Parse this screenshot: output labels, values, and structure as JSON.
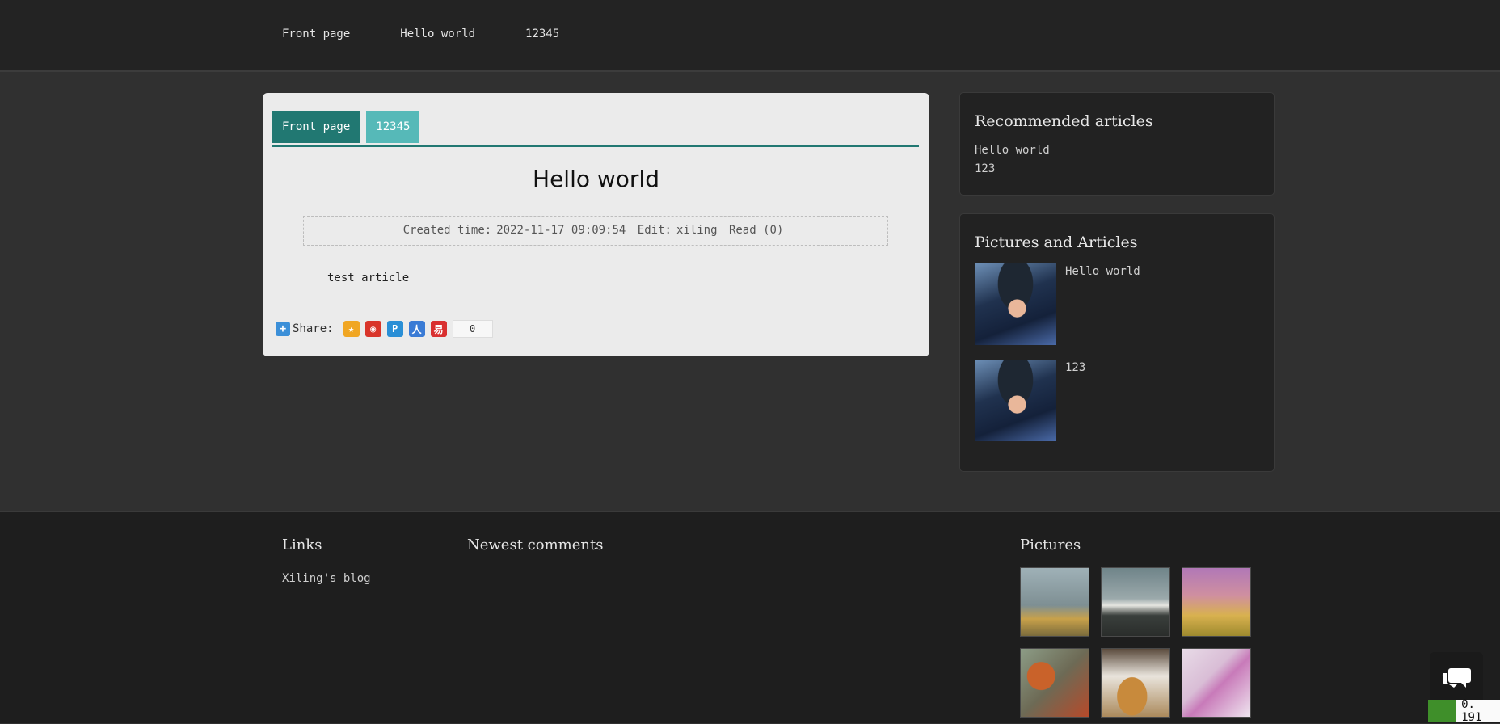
{
  "nav": {
    "items": [
      "Front page",
      "Hello world",
      "12345"
    ]
  },
  "breadcrumb": {
    "home": "Front page",
    "current": "12345"
  },
  "article": {
    "title": "Hello world",
    "created_label": "Created time:",
    "created_value": "2022-11-17 09:09:54",
    "edit_label": "Edit:",
    "edit_value": "xiling",
    "read_label": "Read (0)",
    "body": "test article"
  },
  "share": {
    "label": "Share:",
    "count": "0",
    "icons": [
      "qzone-icon",
      "weibo-icon",
      "tencent-weibo-icon",
      "renren-icon",
      "netease-icon"
    ],
    "colors": [
      "#f0a623",
      "#d9352a",
      "#2a8fd6",
      "#3a7bd5",
      "#d93030"
    ]
  },
  "sidebar": {
    "recommended": {
      "title": "Recommended articles",
      "items": [
        "Hello world",
        "123"
      ]
    },
    "pictures": {
      "title": "Pictures and Articles",
      "items": [
        "Hello world",
        "123"
      ]
    }
  },
  "footer": {
    "links": {
      "title": "Links",
      "items": [
        "Xiling's blog"
      ]
    },
    "comments": {
      "title": "Newest comments"
    },
    "pictures": {
      "title": "Pictures"
    }
  },
  "perf": {
    "value": "0. 191"
  },
  "colors": {
    "accent": "#217872",
    "accent_light": "#56b9b8",
    "page_bg": "#303030",
    "header_bg": "#232323"
  }
}
